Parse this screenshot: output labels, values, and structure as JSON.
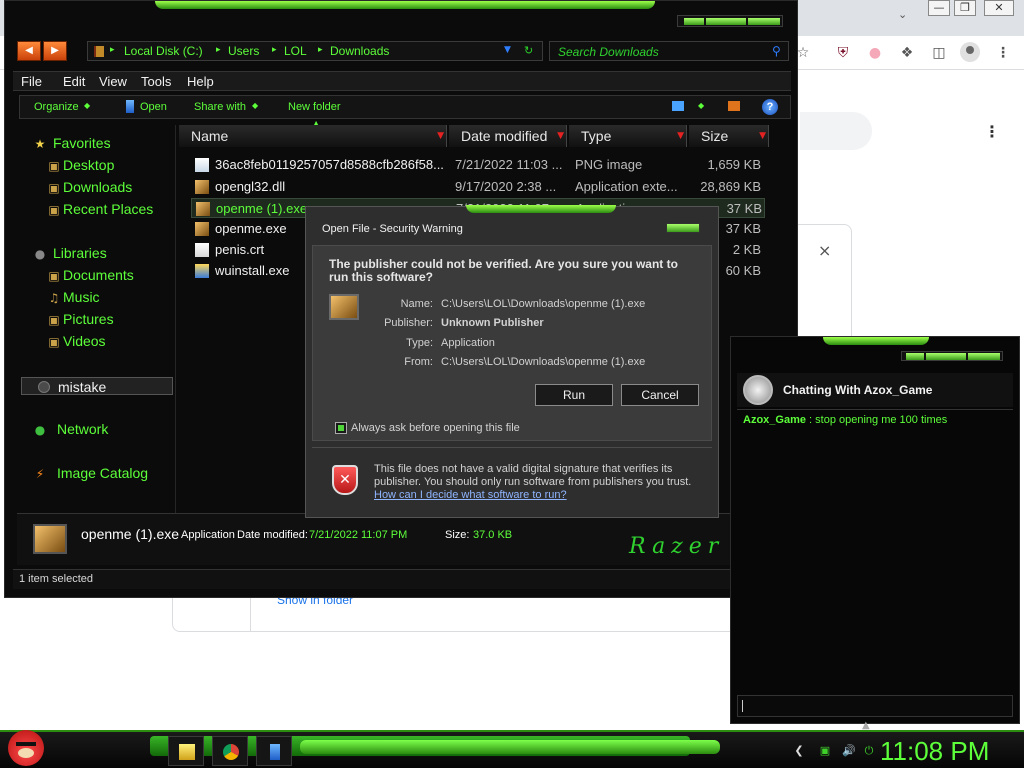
{
  "browser": {
    "extensions": [
      "star-icon",
      "ublock-icon",
      "pride-icon",
      "puzzle-icon",
      "sidepanel-icon",
      "profile-icon",
      "menu-icon"
    ],
    "download_card": {
      "show_in_folder": "Show in folder",
      "close_glyph": "×"
    }
  },
  "explorer": {
    "breadcrumb": [
      "Local Disk (C:)",
      "Users",
      "LOL",
      "Downloads"
    ],
    "search_placeholder": "Search Downloads",
    "menu": [
      "File",
      "Edit",
      "View",
      "Tools",
      "Help"
    ],
    "commands": {
      "organize": "Organize",
      "open": "Open",
      "share_with": "Share with",
      "new_folder": "New folder"
    },
    "sidebar": {
      "favorites": "Favorites",
      "favorites_items": [
        "Desktop",
        "Downloads",
        "Recent Places"
      ],
      "libraries": "Libraries",
      "libraries_items": [
        "Documents",
        "Music",
        "Pictures",
        "Videos"
      ],
      "mistake": "mistake",
      "network": "Network",
      "image_catalog": "Image Catalog"
    },
    "columns": {
      "name": "Name",
      "date": "Date modified",
      "type": "Type",
      "size": "Size"
    },
    "files": [
      {
        "name": "36ac8feb0119257057d8588cfb286f58...",
        "date": "7/21/2022 11:03 ...",
        "type": "PNG image",
        "size": "1,659 KB",
        "selected": false
      },
      {
        "name": "opengl32.dll",
        "date": "9/17/2020 2:38 ...",
        "type": "Application exte...",
        "size": "28,869 KB",
        "selected": false
      },
      {
        "name": "openme (1).exe",
        "date": "7/21/2022 11:07 ...",
        "type": "Application",
        "size": "37 KB",
        "selected": true
      },
      {
        "name": "openme.exe",
        "date": "",
        "type": "",
        "size": "37 KB",
        "selected": false
      },
      {
        "name": "penis.crt",
        "date": "",
        "type": "",
        "size": "2 KB",
        "selected": false
      },
      {
        "name": "wuinstall.exe",
        "date": "",
        "type": "",
        "size": "60 KB",
        "selected": false
      }
    ],
    "details": {
      "name": "openme (1).exe",
      "type_label": "Application",
      "date_label": "Date modified:",
      "date_value": "7/21/2022 11:07 PM",
      "size_label": "Size:",
      "size_value": "37.0 KB",
      "brand": "Razer"
    },
    "status": "1 item selected"
  },
  "dialog": {
    "title": "Open File - Security Warning",
    "question": "The publisher could not be verified.  Are you sure you want to run this software?",
    "fields": [
      {
        "key": "Name:",
        "value": "C:\\Users\\LOL\\Downloads\\openme (1).exe",
        "bold": false
      },
      {
        "key": "Publisher:",
        "value": "Unknown Publisher",
        "bold": true
      },
      {
        "key": "Type:",
        "value": "Application",
        "bold": false
      },
      {
        "key": "From:",
        "value": "C:\\Users\\LOL\\Downloads\\openme (1).exe",
        "bold": false
      }
    ],
    "run": "Run",
    "cancel": "Cancel",
    "always_ask": "Always ask before opening this file",
    "always_ask_checked": true,
    "warning": "This file does not have a valid digital signature that verifies its publisher.  You should only run software from publishers you trust.",
    "link": "How can I decide what software to run?"
  },
  "chat": {
    "title": "Chatting With Azox_Game",
    "messages": [
      {
        "sender": "Azox_Game",
        "separator": " : ",
        "text": "stop opening me 100 times"
      }
    ]
  },
  "taskbar": {
    "apps": [
      "explorer-icon",
      "chrome-icon",
      "notepad-icon"
    ],
    "clock": "11:08 PM"
  },
  "colors": {
    "accent": "#5dff3a",
    "brand_green": "#2b8c10",
    "chrome_bg": "#dee1e6"
  }
}
